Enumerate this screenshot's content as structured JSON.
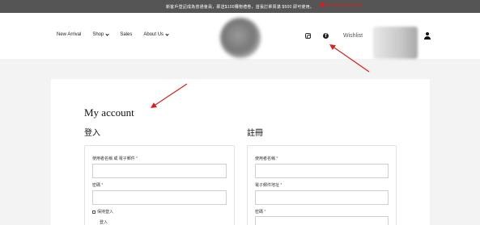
{
  "announcement": "新客戶登記成為普通會員，即送$100購物禮卷，首張訂單買滿 $500 即可使用。",
  "nav": {
    "items": [
      {
        "label": "New Arrival",
        "dropdown": false
      },
      {
        "label": "Shop",
        "dropdown": true
      },
      {
        "label": "Sales",
        "dropdown": false
      },
      {
        "label": "About Us",
        "dropdown": true
      }
    ]
  },
  "header": {
    "wishlist_label": "Wishlist",
    "icons": [
      "instagram-icon",
      "facebook-icon",
      "user-icon"
    ]
  },
  "main": {
    "title": "My account",
    "login": {
      "title": "登入",
      "username_label": "使用者名稱 或 電子郵件",
      "password_label": "密碼",
      "remember_label": "保持登入",
      "submit_label": "登入"
    },
    "register": {
      "title": "註冊",
      "username_label": "使用者名稱",
      "email_label": "電子郵件地址",
      "password_label": "密碼"
    }
  },
  "colors": {
    "announcement_bg": "#555555",
    "page_bg": "#f3f3f3",
    "arrow": "#d42020",
    "required": "#c0392b"
  }
}
